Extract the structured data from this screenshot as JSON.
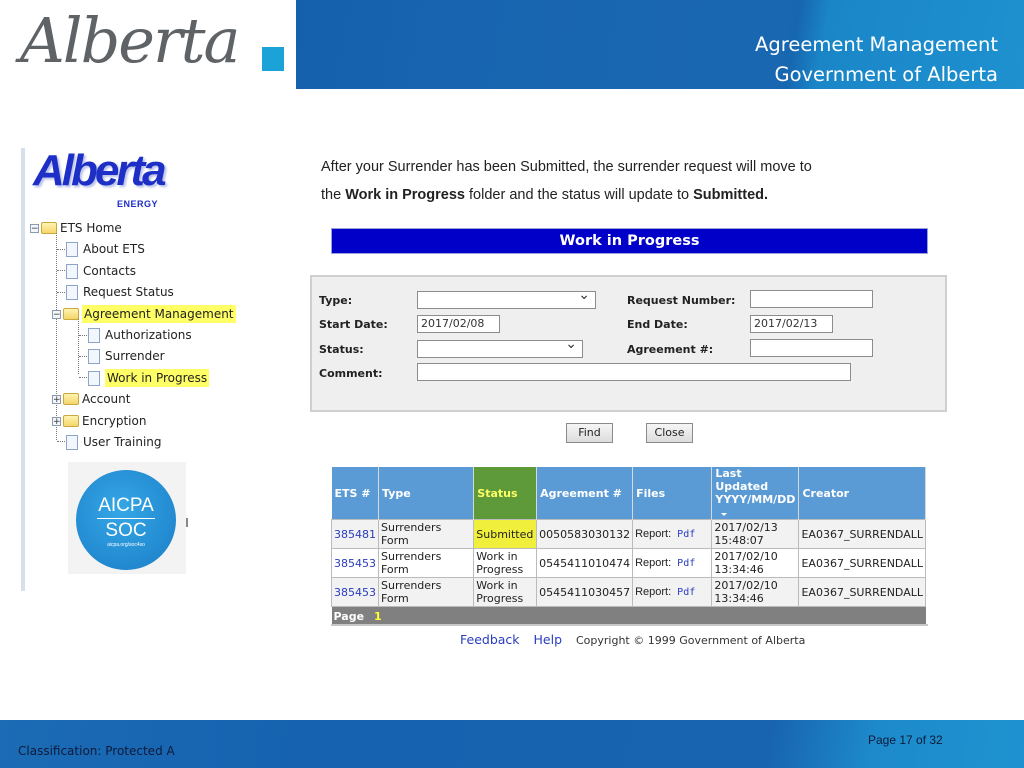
{
  "header": {
    "logo_text": "Alberta",
    "title_line1": "Agreement Management",
    "title_line2": "Government of Alberta"
  },
  "nav": {
    "logo_text": "Alberta",
    "logo_subtext": "ENERGY",
    "tree": [
      {
        "label": "ETS Home",
        "type": "folder",
        "expander": "minus"
      },
      {
        "label": "About ETS",
        "type": "page"
      },
      {
        "label": "Contacts",
        "type": "page"
      },
      {
        "label": "Request Status",
        "type": "page"
      },
      {
        "label": "Agreement Management",
        "type": "folder",
        "expander": "minus",
        "highlighted": true
      },
      {
        "label": "Authorizations",
        "type": "page"
      },
      {
        "label": "Surrender",
        "type": "page"
      },
      {
        "label": "Work in Progress",
        "type": "page",
        "highlighted": true
      },
      {
        "label": "Account",
        "type": "folder",
        "expander": "plus"
      },
      {
        "label": "Encryption",
        "type": "folder",
        "expander": "plus"
      },
      {
        "label": "User Training",
        "type": "page"
      }
    ],
    "badge": {
      "line1": "AICPA",
      "line2": "SOC",
      "line3": "aicpa.org/soc4so"
    }
  },
  "description": {
    "line1": "After your Surrender has been Submitted, the surrender  request will move to",
    "line2_prefix": "the ",
    "line2_bold1": "Work in Progress",
    "line2_mid": " folder and the status will update to ",
    "line2_bold2": "Submitted."
  },
  "section_title": "Work in Progress",
  "form": {
    "type_label": "Type:",
    "type_value": "",
    "start_date_label": "Start Date:",
    "start_date_value": "2017/02/08",
    "status_label": "Status:",
    "status_value": "",
    "comment_label": "Comment:",
    "comment_value": "",
    "request_number_label": "Request Number:",
    "request_number_value": "",
    "end_date_label": "End Date:",
    "end_date_value": "2017/02/13",
    "agreement_label": "Agreement #:",
    "agreement_value": ""
  },
  "buttons": {
    "find": "Find",
    "close": "Close"
  },
  "table": {
    "headers": {
      "ets": "ETS #",
      "type": "Type",
      "status": "Status",
      "agreement": "Agreement #",
      "files": "Files",
      "last_updated_1": "Last Updated",
      "last_updated_2": "YYYY/MM/DD",
      "creator": "Creator"
    },
    "rows": [
      {
        "ets": "385481",
        "type": "Surrenders Form",
        "status": "Submitted",
        "agreement": "0050583030132",
        "files_label": "Report:",
        "files_link": "Pdf",
        "date": "2017/02/13",
        "time": "15:48:07",
        "creator": "EA0367_SURRENDALL"
      },
      {
        "ets": "385453",
        "type": "Surrenders Form",
        "status": "Work in Progress",
        "agreement": "0545411010474",
        "files_label": "Report:",
        "files_link": "Pdf",
        "date": "2017/02/10",
        "time": "13:34:46",
        "creator": "EA0367_SURRENDALL"
      },
      {
        "ets": "385453",
        "type": "Surrenders Form",
        "status": "Work in Progress",
        "agreement": "0545411030457",
        "files_label": "Report:",
        "files_link": "Pdf",
        "date": "2017/02/10",
        "time": "13:34:46",
        "creator": "EA0367_SURRENDALL"
      }
    ],
    "pager_label": "Page",
    "pager_current": "1"
  },
  "footer_links": {
    "feedback": "Feedback",
    "help": "Help",
    "copyright": "Copyright © 1999 Government of Alberta"
  },
  "slide_footer": {
    "classification": "Classification: Protected A",
    "page": "Page 17 of 32"
  },
  "colors": {
    "brand_blue": "#1864b0",
    "section_bar": "#0000c8",
    "table_header": "#5b9bd5",
    "status_header": "#5e9a3a",
    "highlight": "#ffff66"
  }
}
